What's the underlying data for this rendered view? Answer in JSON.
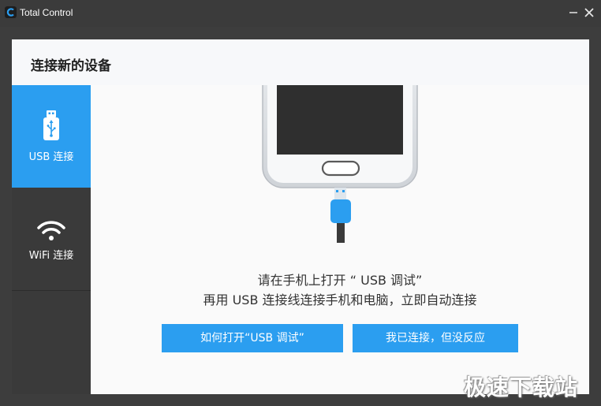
{
  "titlebar": {
    "app_title": "Total Control",
    "minimize_glyph": "—",
    "close_glyph": "✕"
  },
  "dialog": {
    "title": "连接新的设备"
  },
  "sidebar": {
    "items": [
      {
        "label": "USB 连接",
        "icon": "usb-icon",
        "active": true
      },
      {
        "label": "WiFi 连接",
        "icon": "wifi-icon",
        "active": false
      }
    ]
  },
  "content": {
    "instruction_line1": "请在手机上打开 “ USB 调试”",
    "instruction_line2": "再用 USB 连接线连接手机和电脑，立即自动连接",
    "button_how_to": "如何打开“USB 调试”",
    "button_no_response": "我已连接，但没反应"
  },
  "watermark": "极速下载站",
  "colors": {
    "accent": "#2b9ef0",
    "titlebar": "#3b3b3b",
    "sidebar": "#3a3a3a",
    "content_bg": "#fafafa"
  }
}
